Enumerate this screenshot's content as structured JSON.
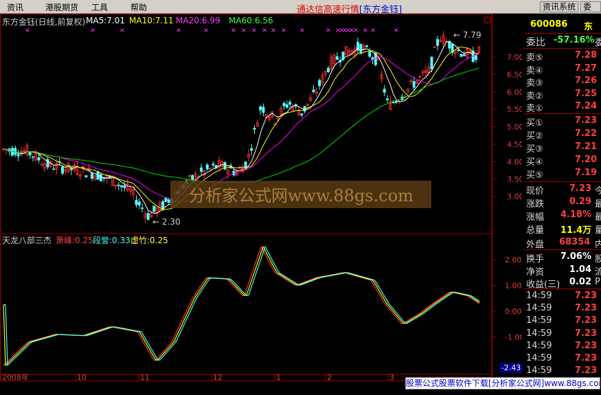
{
  "menu": {
    "items": [
      "资讯",
      "港股期货",
      "工具",
      "帮助"
    ]
  },
  "app_title": {
    "text": "通达信高速行情",
    "stock": "[东方金钰]"
  },
  "toolbar": {
    "btn1": "资讯系统",
    "btn2": "委托"
  },
  "main_chart": {
    "header_name": "东方金钰(日线,前复权)",
    "ma5": "MA5:7.01",
    "ma10": "MA10:7.11",
    "ma20": "MA20:6.99",
    "ma60": "MA60:6.56",
    "high_label": "7.79",
    "low_label": "2.30",
    "y_ticks": [
      "7.00",
      "6.50",
      "6.00",
      "5.50",
      "5.00",
      "4.50",
      "4.00",
      "3.50",
      "3.00"
    ],
    "watermark": "分析家公式网www.88gs.com"
  },
  "indicator": {
    "name": "天龙八部三杰",
    "l1": "萧峰:0.25",
    "l2": "段誉:0.33",
    "l3": "虚竹:0.25",
    "y_ticks": [
      "2.00",
      "1.00",
      "0.00",
      "-1.00"
    ],
    "cursor_value": "-2.43"
  },
  "x_axis": {
    "labels": [
      "2008年",
      "10",
      "11",
      "12",
      "1",
      "2",
      "3"
    ]
  },
  "colors": {
    "up": "#ff3030",
    "down": "#54fcfc",
    "ma5": "#ffffff",
    "ma10": "#ffff00",
    "ma20": "#ff00ff",
    "ma60": "#00e000"
  },
  "chart_data": {
    "type": "candlestick",
    "title": "东方金钰(日线,前复权)",
    "ylim": [
      2.3,
      7.79
    ],
    "x_labels": [
      "2008年",
      "10",
      "11",
      "12",
      "1",
      "2",
      "3"
    ],
    "ma": {
      "MA5": 7.01,
      "MA10": 7.11,
      "MA20": 6.99,
      "MA60": 6.56
    },
    "annotations": {
      "high": 7.79,
      "low": 2.3
    },
    "indicator": {
      "name": "天龙八部三杰",
      "series": [
        {
          "name": "萧峰",
          "last": 0.25
        },
        {
          "name": "段誉",
          "last": 0.33
        },
        {
          "name": "虚竹",
          "last": 0.25
        }
      ],
      "ylim": [
        -2.43,
        2.5
      ]
    }
  },
  "quote": {
    "code": "600086",
    "name_short": "东",
    "weibi_label": "委比",
    "weibi_value": "-57.16%",
    "weibi_suffix": "委",
    "sells": [
      {
        "label": "卖⑤",
        "price": "7.28"
      },
      {
        "label": "卖④",
        "price": "7.27"
      },
      {
        "label": "卖③",
        "price": "7.26"
      },
      {
        "label": "卖②",
        "price": "7.25"
      },
      {
        "label": "卖①",
        "price": "7.24"
      }
    ],
    "buys": [
      {
        "label": "买①",
        "price": "7.23"
      },
      {
        "label": "买②",
        "price": "7.22"
      },
      {
        "label": "买③",
        "price": "7.21"
      },
      {
        "label": "买④",
        "price": "7.20"
      },
      {
        "label": "买⑤",
        "price": "7.19"
      }
    ],
    "stats": [
      {
        "label": "现价",
        "value": "7.23",
        "suffix": "今"
      },
      {
        "label": "涨跌",
        "value": "0.29",
        "suffix": "最"
      },
      {
        "label": "涨幅",
        "value": "4.18%",
        "suffix": "最"
      },
      {
        "label": "总量",
        "value": "11.4万",
        "suffix": "量"
      }
    ],
    "waipan_label": "外盘",
    "waipan_value": "68354",
    "waipan_suffix": "内",
    "stats2": [
      {
        "label": "换手",
        "value": "7.06%",
        "suffix": "股"
      },
      {
        "label": "净资",
        "value": "1.04",
        "suffix": "流"
      },
      {
        "label": "收益(三)",
        "value": "0.02",
        "suffix": "P"
      }
    ],
    "ticks": [
      {
        "time": "14:59",
        "price": "7.23"
      },
      {
        "time": "14:59",
        "price": "7.23"
      },
      {
        "time": "14:59",
        "price": "7.23"
      },
      {
        "time": "14:59",
        "price": "7.23"
      },
      {
        "time": "14:59",
        "price": "7.23"
      },
      {
        "time": "14:59",
        "price": "7.23"
      },
      {
        "time": "14:59",
        "price": "7.23"
      },
      {
        "time": "14:59",
        "price": "7.23"
      }
    ]
  },
  "footer": {
    "text": "股票公式股票软件下载[分析家公式网]www.88gs.com"
  }
}
